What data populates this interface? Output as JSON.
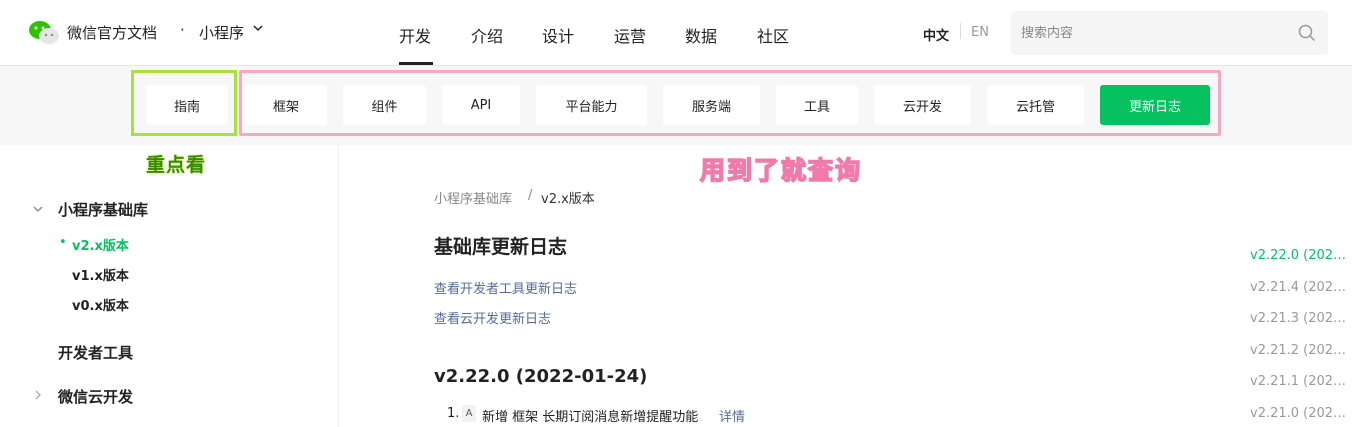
{
  "brand": {
    "name": "微信官方文档",
    "dot": "·",
    "product": "小程序"
  },
  "nav": [
    "开发",
    "介绍",
    "设计",
    "运营",
    "数据",
    "社区"
  ],
  "lang": {
    "zh": "中文",
    "en": "EN"
  },
  "search": {
    "placeholder": "搜索内容"
  },
  "tabs": [
    "指南",
    "框架",
    "组件",
    "API",
    "平台能力",
    "服务端",
    "工具",
    "云开发",
    "云托管",
    "更新日志"
  ],
  "annotations": {
    "green": "重点看",
    "pink": "用到了就查询"
  },
  "sidebar": {
    "section1": "小程序基础库",
    "sub": [
      "v2.x版本",
      "v1.x版本",
      "v0.x版本"
    ],
    "section2": "开发者工具",
    "section3": "微信云开发"
  },
  "breadcrumb": {
    "parent": "小程序基础库",
    "sep": "/",
    "current": "v2.x版本"
  },
  "content": {
    "title": "基础库更新日志",
    "links": [
      "查看开发者工具更新日志",
      "查看云开发更新日志"
    ],
    "heading": "v2.22.0 (2022-01-24)",
    "item": {
      "num": "1.",
      "badge": "A",
      "text": "新增 框架 长期订阅消息新增提醒功能",
      "link": "详情"
    }
  },
  "toc": [
    "v2.22.0 (202…",
    "v2.21.4 (202…",
    "v2.21.3 (202…",
    "v2.21.2 (202…",
    "v2.21.1 (202…",
    "v2.21.0 (202…"
  ],
  "colors": {
    "accent": "#07c160",
    "link": "#576b95",
    "annotation_green": "#a8e13c",
    "annotation_pink": "#f5a9c6"
  }
}
